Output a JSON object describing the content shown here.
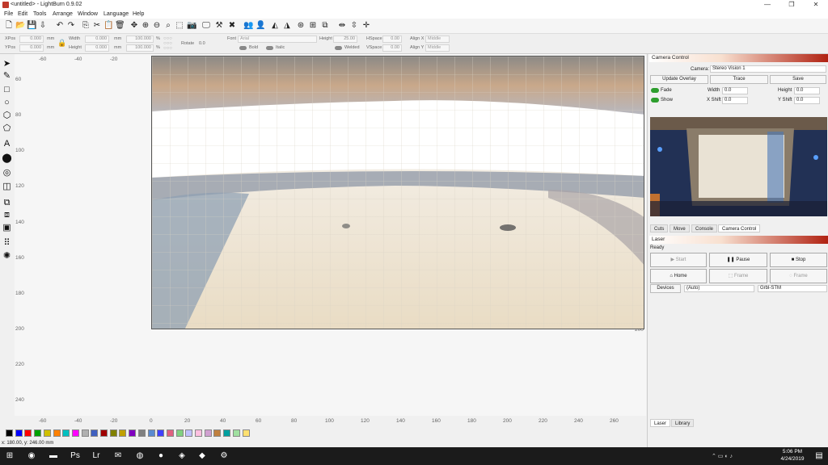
{
  "window": {
    "title": "<untitled> - LightBurn 0.9.02",
    "minimize": "—",
    "maximize": "❐",
    "close": "✕"
  },
  "menu": [
    "File",
    "Edit",
    "Tools",
    "Arrange",
    "Window",
    "Language",
    "Help"
  ],
  "props": {
    "xpos_label": "XPos",
    "xpos": "0.000",
    "ypos_label": "YPos",
    "ypos": "0.000",
    "unit": "mm",
    "width_label": "Width",
    "width": "0.000",
    "height_label": "Height",
    "height": "0.000",
    "wpct": "100.000",
    "hpct": "100.000",
    "pct": "%",
    "rotate_label": "Rotate",
    "rotate": "0.0",
    "font_label": "Font",
    "font": "Arial",
    "fheight_label": "Height",
    "fheight": "25.00",
    "hspace_label": "HSpace",
    "hspace": "0.00",
    "vspace_label": "VSpace",
    "vspace": "0.00",
    "alignx_label": "Align X",
    "alignx": "Middle",
    "aligny_label": "Align Y",
    "aligny": "Middle",
    "bold": "Bold",
    "italic": "Italic",
    "welded": "Welded"
  },
  "ruler": {
    "left": [
      "60",
      "80",
      "100",
      "120",
      "140",
      "160",
      "180",
      "200",
      "220",
      "240"
    ],
    "right": [
      "200"
    ],
    "top": [
      "-60",
      "-40",
      "-20"
    ],
    "bottom": [
      "-60",
      "-40",
      "-20",
      "0",
      "20",
      "40",
      "60",
      "80",
      "100",
      "120",
      "140",
      "160",
      "180",
      "200",
      "220",
      "240",
      "260"
    ]
  },
  "status": "x: 180.00, y: 246.00 mm",
  "palette": {
    "colors": [
      "#000000",
      "#0000ff",
      "#ff0000",
      "#00a000",
      "#d0c000",
      "#ff8000",
      "#00c0c0",
      "#ff00ff",
      "#b0b0b0",
      "#4060c0",
      "#a00000",
      "#808000",
      "#c0a000",
      "#8000c0",
      "#808080",
      "#5a8ad0",
      "#4040ff",
      "#e06080",
      "#80d080",
      "#c0c0ff",
      "#ffc0e0",
      "#d0a0d0",
      "#c08040",
      "#00a0a0",
      "#a0e0a0",
      "#ffe070"
    ]
  },
  "camera": {
    "header": "Camera Control",
    "camera_label": "Camera:",
    "camera_value": "Stereo Vision 1",
    "update_overlay": "Update Overlay",
    "trace": "Trace",
    "save": "Save",
    "fade": "Fade",
    "show": "Show",
    "width_label": "Width",
    "width": "0.0",
    "height_label": "Height",
    "height": "0.0",
    "xshift_label": "X Shift",
    "xshift": "0.0",
    "yshift_label": "Y Shift",
    "yshift": "0.0"
  },
  "tabs": [
    "Cuts",
    "Move",
    "Console",
    "Camera Control"
  ],
  "laser": {
    "header": "Laser",
    "status": "Ready",
    "start": "Start",
    "pause": "Pause",
    "stop": "Stop",
    "home": "Home",
    "frame1": "Frame",
    "frame2": "Frame",
    "devices": "Devices",
    "port": "(Auto)",
    "controller": "Grbl-STM"
  },
  "bottom_tabs": [
    "Laser",
    "Library"
  ],
  "taskbar": {
    "time": "5:06 PM",
    "date": "4/24/2019"
  }
}
